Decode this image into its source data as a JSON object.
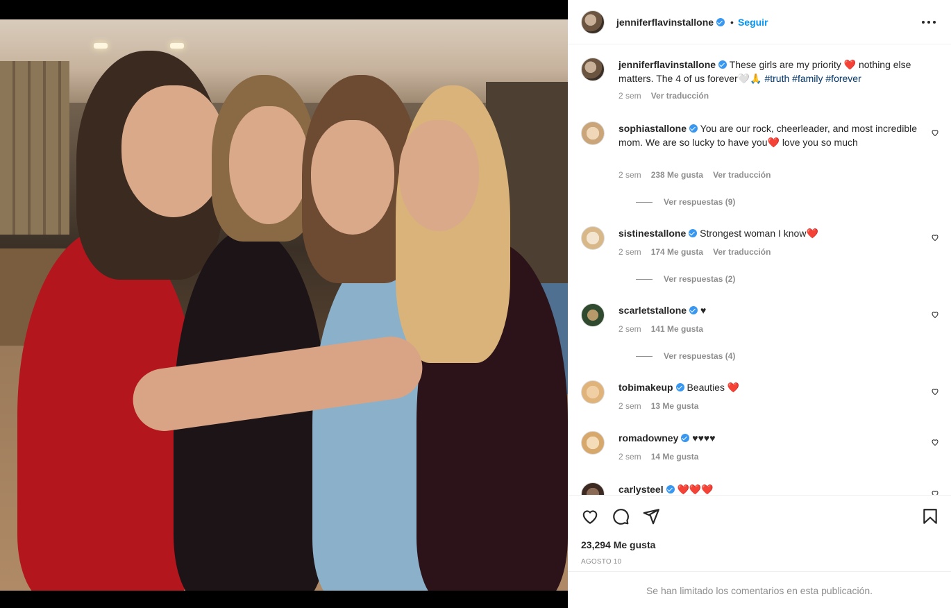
{
  "post": {
    "username": "jenniferflavinstallone",
    "follow_label": "Seguir",
    "separator": "•"
  },
  "caption": {
    "username": "jenniferflavinstallone",
    "text_part1": "These girls are my priority ",
    "heart": "❤️",
    "text_part2": " nothing else matters. The 4 of us forever🤍🙏 ",
    "hashtags": "#truth #family #forever",
    "time": "2 sem",
    "translate": "Ver traducción"
  },
  "comments": [
    {
      "username": "sophiastallone",
      "text": "You are our rock, cheerleader, and most incredible mom. We are so lucky to have you❤️ love you so much",
      "time": "2 sem",
      "likes": "238 Me gusta",
      "translate": "Ver traducción",
      "replies": "Ver respuestas (9)"
    },
    {
      "username": "sistinestallone",
      "text": "Strongest woman I know❤️",
      "time": "2 sem",
      "likes": "174 Me gusta",
      "translate": "Ver traducción",
      "replies": "Ver respuestas (2)"
    },
    {
      "username": "scarletstallone",
      "text": "♥",
      "time": "2 sem",
      "likes": "141 Me gusta",
      "replies": "Ver respuestas (4)"
    },
    {
      "username": "tobimakeup",
      "text": "Beauties ❤️",
      "time": "2 sem",
      "likes": "13 Me gusta"
    },
    {
      "username": "romadowney",
      "text": "♥♥♥♥",
      "time": "2 sem",
      "likes": "14 Me gusta"
    },
    {
      "username": "carlysteel",
      "text": "❤️❤️❤️"
    }
  ],
  "footer": {
    "likes": "23,294 Me gusta",
    "date": "AGOSTO 10",
    "limited": "Se han limitado los comentarios en esta publicación."
  },
  "icons": [
    "more-icon",
    "like-icon",
    "comment-icon",
    "share-icon",
    "save-icon",
    "verified-icon",
    "comment-like-icon"
  ],
  "colors": {
    "accent": "#0095f6",
    "verified": "#3897f0",
    "hashtag": "#00376b",
    "muted": "#8e8e8e"
  }
}
